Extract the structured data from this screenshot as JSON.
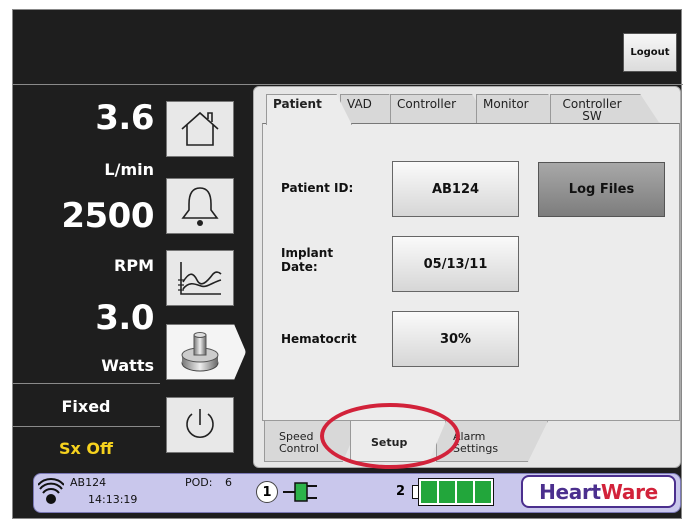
{
  "header": {
    "logout_label": "Logout"
  },
  "readouts": [
    {
      "value": "3.6",
      "unit": "L/min"
    },
    {
      "value": "2500",
      "unit": "RPM"
    },
    {
      "value": "3.0",
      "unit": "Watts"
    }
  ],
  "mode": {
    "control": "Fixed",
    "suction": "Sx Off"
  },
  "nav": [
    {
      "icon": "home-icon"
    },
    {
      "icon": "bell-icon"
    },
    {
      "icon": "waveform-icon"
    },
    {
      "icon": "pump-icon"
    },
    {
      "icon": "power-icon"
    }
  ],
  "tabs": [
    {
      "label": "Patient"
    },
    {
      "label": "VAD"
    },
    {
      "label": "Controller"
    },
    {
      "label": "Monitor"
    },
    {
      "label": "Controller SW"
    }
  ],
  "patient": {
    "id_label": "Patient ID:",
    "id_value": "AB124",
    "log_files_label": "Log Files",
    "implant_label_1": "Implant",
    "implant_label_2": "Date:",
    "implant_value": "05/13/11",
    "hematocrit_label": "Hematocrit",
    "hematocrit_value": "30%"
  },
  "bottom_tabs": [
    {
      "line1": "Speed",
      "line2": "Control"
    },
    {
      "line1": "Setup",
      "line2": ""
    },
    {
      "line1": "Alarm",
      "line2": "Settings"
    }
  ],
  "status": {
    "device_id": "AB124",
    "time": "14:13:19",
    "pod_label": "POD:",
    "pod_value": "6",
    "source1": "1",
    "source2": "2",
    "battery_cells": 4,
    "logo_part1": "Heart",
    "logo_part2": "Ware"
  },
  "colors": {
    "accent": "#4b2f8e",
    "alert": "#d2223a",
    "warning_text": "#f6d21e",
    "battery": "#22a63b"
  }
}
